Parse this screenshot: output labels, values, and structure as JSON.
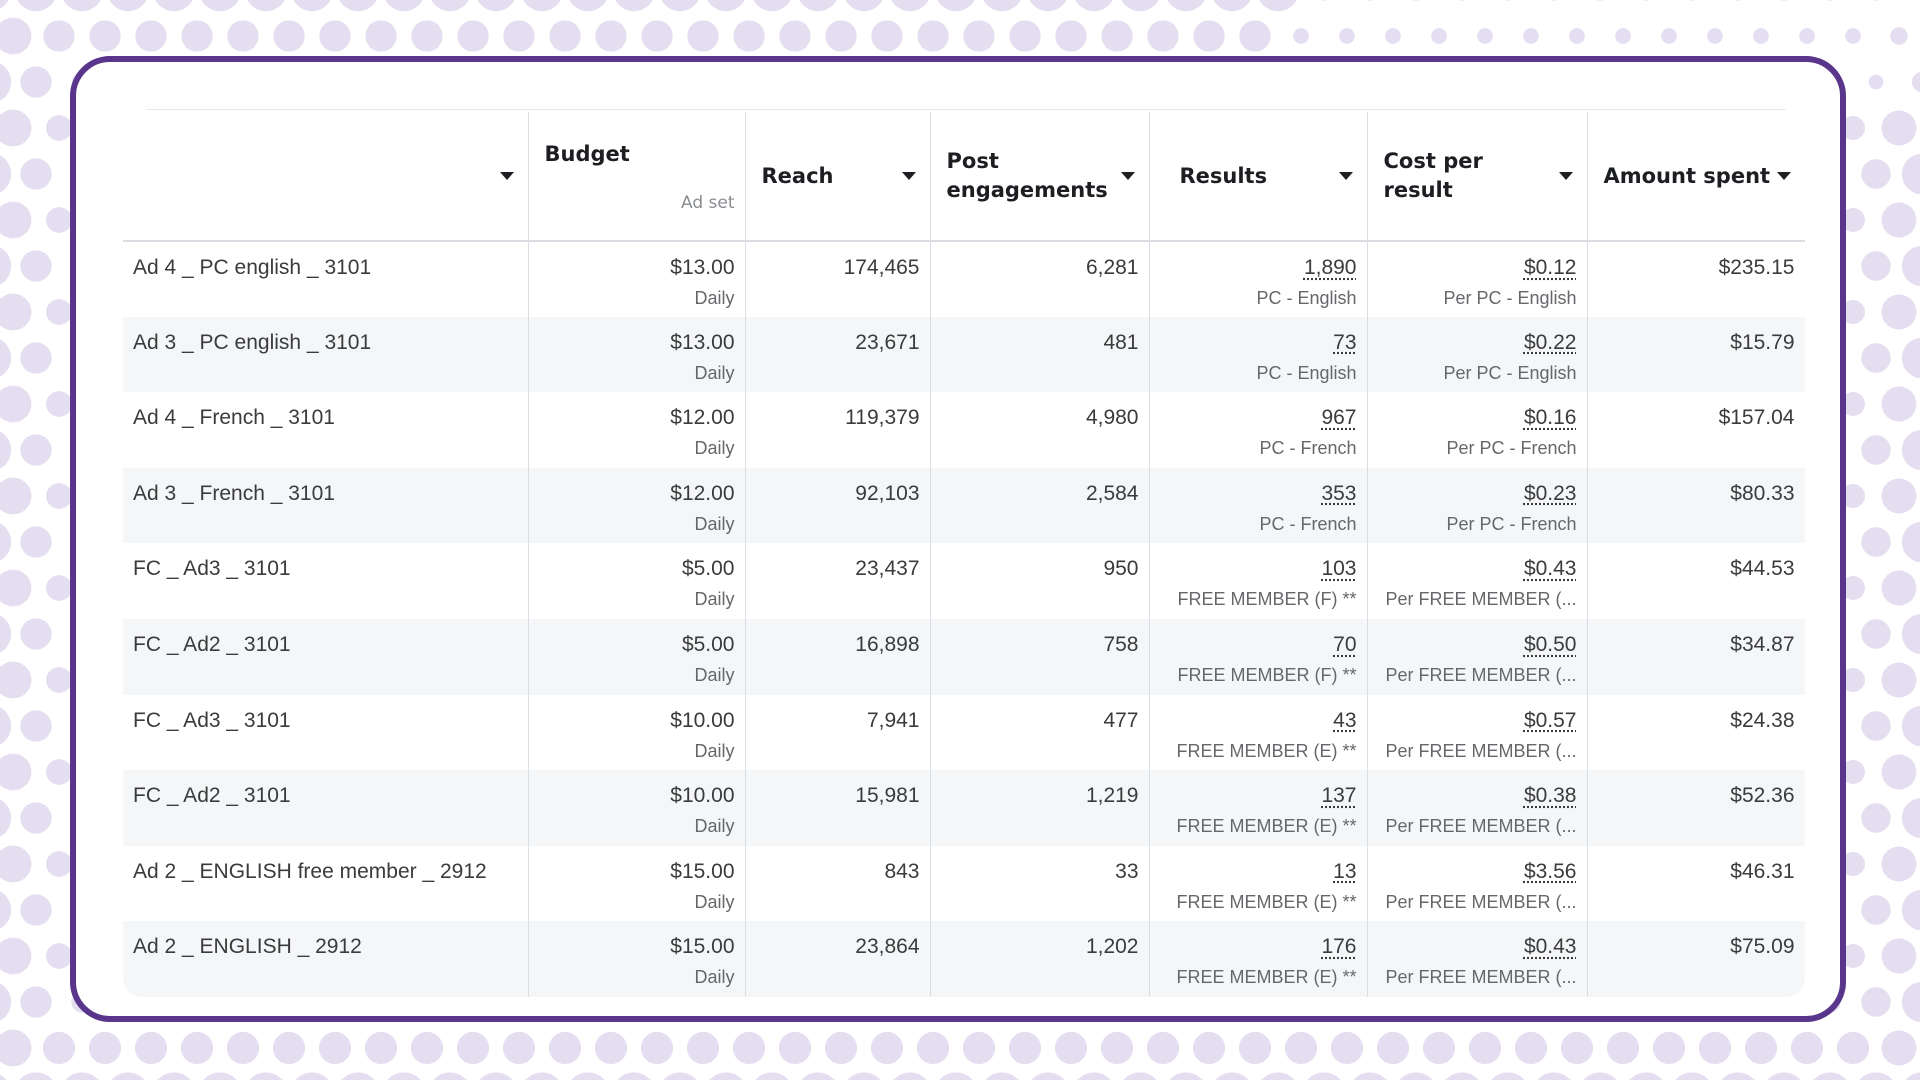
{
  "colors": {
    "frame": "#59358c",
    "dots": "#e4def0",
    "row_alt": "#f5f6f7",
    "header_text": "#1c1e21",
    "cell_text": "#3a3b3c",
    "sub_text": "#65676b"
  },
  "table": {
    "headers": {
      "name": "",
      "budget": "Budget",
      "budget_sub": "Ad set",
      "reach": "Reach",
      "post_engagements": "Post engagements",
      "results": "Results",
      "cost_per_result": "Cost per result",
      "amount_spent": "Amount spent"
    },
    "rows": [
      {
        "name": "Ad 4 _ PC english _ 3101",
        "budget": "$13.00",
        "budget_period": "Daily",
        "reach": "174,465",
        "engagements": "6,281",
        "results": "1,890",
        "results_type": "PC - English",
        "cost": "$0.12",
        "cost_type": "Per PC - English",
        "spent": "$235.15"
      },
      {
        "name": "Ad 3 _ PC english _ 3101",
        "budget": "$13.00",
        "budget_period": "Daily",
        "reach": "23,671",
        "engagements": "481",
        "results": "73",
        "results_type": "PC - English",
        "cost": "$0.22",
        "cost_type": "Per PC - English",
        "spent": "$15.79"
      },
      {
        "name": "Ad 4 _ French _ 3101",
        "budget": "$12.00",
        "budget_period": "Daily",
        "reach": "119,379",
        "engagements": "4,980",
        "results": "967",
        "results_type": "PC - French",
        "cost": "$0.16",
        "cost_type": "Per PC - French",
        "spent": "$157.04"
      },
      {
        "name": "Ad 3 _ French _ 3101",
        "budget": "$12.00",
        "budget_period": "Daily",
        "reach": "92,103",
        "engagements": "2,584",
        "results": "353",
        "results_type": "PC - French",
        "cost": "$0.23",
        "cost_type": "Per PC - French",
        "spent": "$80.33"
      },
      {
        "name": "FC _ Ad3 _ 3101",
        "budget": "$5.00",
        "budget_period": "Daily",
        "reach": "23,437",
        "engagements": "950",
        "results": "103",
        "results_type": "FREE MEMBER (F) **",
        "cost": "$0.43",
        "cost_type": "Per FREE MEMBER (...",
        "spent": "$44.53"
      },
      {
        "name": "FC _ Ad2 _ 3101",
        "budget": "$5.00",
        "budget_period": "Daily",
        "reach": "16,898",
        "engagements": "758",
        "results": "70",
        "results_type": "FREE MEMBER (F) **",
        "cost": "$0.50",
        "cost_type": "Per FREE MEMBER (...",
        "spent": "$34.87"
      },
      {
        "name": "FC _ Ad3 _ 3101",
        "budget": "$10.00",
        "budget_period": "Daily",
        "reach": "7,941",
        "engagements": "477",
        "results": "43",
        "results_type": "FREE MEMBER (E) **",
        "cost": "$0.57",
        "cost_type": "Per FREE MEMBER (...",
        "spent": "$24.38"
      },
      {
        "name": "FC _ Ad2 _ 3101",
        "budget": "$10.00",
        "budget_period": "Daily",
        "reach": "15,981",
        "engagements": "1,219",
        "results": "137",
        "results_type": "FREE MEMBER (E) **",
        "cost": "$0.38",
        "cost_type": "Per FREE MEMBER (...",
        "spent": "$52.36"
      },
      {
        "name": "Ad 2 _ ENGLISH free member _ 2912",
        "budget": "$15.00",
        "budget_period": "Daily",
        "reach": "843",
        "engagements": "33",
        "results": "13",
        "results_type": "FREE MEMBER (E) **",
        "cost": "$3.56",
        "cost_type": "Per FREE MEMBER (...",
        "spent": "$46.31"
      },
      {
        "name": "Ad 2 _ ENGLISH _ 2912",
        "budget": "$15.00",
        "budget_period": "Daily",
        "reach": "23,864",
        "engagements": "1,202",
        "results": "176",
        "results_type": "FREE MEMBER (E) **",
        "cost": "$0.43",
        "cost_type": "Per FREE MEMBER (...",
        "spent": "$75.09"
      }
    ]
  }
}
